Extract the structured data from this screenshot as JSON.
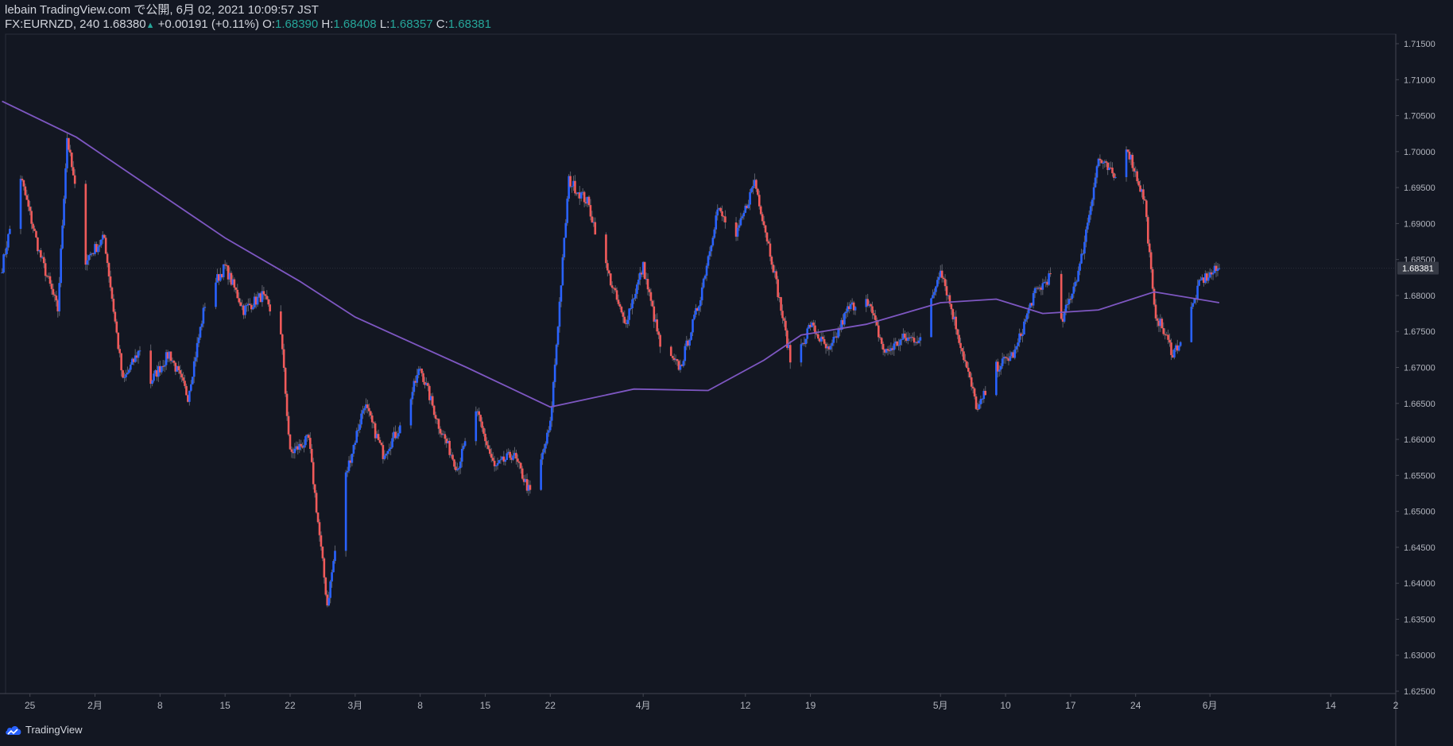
{
  "header": {
    "publish_line": "lebain TradingView.com で公開, 6月 02, 2021 10:09:57 JST",
    "symbol": "FX:EURNZD, 240",
    "last": "1.68380",
    "arrow": "▲",
    "change": "+0.00191 (+0.11%)",
    "o_label": "O:",
    "o_value": "1.68390",
    "h_label": "H:",
    "h_value": "1.68408",
    "l_label": "L:",
    "l_value": "1.68357",
    "c_label": "C:",
    "c_value": "1.68381"
  },
  "brand": {
    "name": "TradingView",
    "logo_icon": "tradingview-cloud-icon"
  },
  "colors": {
    "background": "#131722",
    "up": "#2962ff",
    "down": "#f05a5a",
    "ma_line": "#7e57c2",
    "price_label_bg": "#363a45",
    "axis_text": "#b2b5be"
  },
  "chart_data": {
    "type": "candlestick",
    "series": [
      {
        "name": "EURNZD, 240",
        "kind": "ohlc",
        "anchors": [
          {
            "date": "2021-01-22",
            "close": 1.684
          },
          {
            "date": "2021-01-24",
            "close": 1.6965
          },
          {
            "date": "2021-01-26",
            "close": 1.686
          },
          {
            "date": "2021-01-28",
            "close": 1.678
          },
          {
            "date": "2021-01-29",
            "close": 1.702
          },
          {
            "date": "2021-01-31",
            "close": 1.685
          },
          {
            "date": "2021-02-02",
            "close": 1.688
          },
          {
            "date": "2021-02-04",
            "close": 1.668
          },
          {
            "date": "2021-02-06",
            "close": 1.673
          },
          {
            "date": "2021-02-07",
            "close": 1.668
          },
          {
            "date": "2021-02-09",
            "close": 1.672
          },
          {
            "date": "2021-02-11",
            "close": 1.666
          },
          {
            "date": "2021-02-13",
            "close": 1.68
          },
          {
            "date": "2021-02-15",
            "close": 1.684
          },
          {
            "date": "2021-02-17",
            "close": 1.678
          },
          {
            "date": "2021-02-19",
            "close": 1.68
          },
          {
            "date": "2021-02-21",
            "close": 1.675
          },
          {
            "date": "2021-02-22",
            "close": 1.658
          },
          {
            "date": "2021-02-24",
            "close": 1.66
          },
          {
            "date": "2021-02-26",
            "close": 1.637
          },
          {
            "date": "2021-02-28",
            "close": 1.655
          },
          {
            "date": "2021-03-02",
            "close": 1.665
          },
          {
            "date": "2021-03-04",
            "close": 1.658
          },
          {
            "date": "2021-03-06",
            "close": 1.662
          },
          {
            "date": "2021-03-08",
            "close": 1.67
          },
          {
            "date": "2021-03-10",
            "close": 1.662
          },
          {
            "date": "2021-03-12",
            "close": 1.656
          },
          {
            "date": "2021-03-14",
            "close": 1.664
          },
          {
            "date": "2021-03-16",
            "close": 1.656
          },
          {
            "date": "2021-03-18",
            "close": 1.658
          },
          {
            "date": "2021-03-20",
            "close": 1.652
          },
          {
            "date": "2021-03-22",
            "close": 1.662
          },
          {
            "date": "2021-03-24",
            "close": 1.696
          },
          {
            "date": "2021-03-26",
            "close": 1.693
          },
          {
            "date": "2021-03-28",
            "close": 1.684
          },
          {
            "date": "2021-03-30",
            "close": 1.676
          },
          {
            "date": "2021-04-01",
            "close": 1.684
          },
          {
            "date": "2021-04-03",
            "close": 1.672
          },
          {
            "date": "2021-04-05",
            "close": 1.67
          },
          {
            "date": "2021-04-07",
            "close": 1.679
          },
          {
            "date": "2021-04-09",
            "close": 1.692
          },
          {
            "date": "2021-04-11",
            "close": 1.688
          },
          {
            "date": "2021-04-13",
            "close": 1.696
          },
          {
            "date": "2021-04-15",
            "close": 1.684
          },
          {
            "date": "2021-04-17",
            "close": 1.67
          },
          {
            "date": "2021-04-19",
            "close": 1.676
          },
          {
            "date": "2021-04-21",
            "close": 1.672
          },
          {
            "date": "2021-04-23",
            "close": 1.678
          },
          {
            "date": "2021-04-25",
            "close": 1.68
          },
          {
            "date": "2021-04-27",
            "close": 1.672
          },
          {
            "date": "2021-04-29",
            "close": 1.674
          },
          {
            "date": "2021-05-01",
            "close": 1.674
          },
          {
            "date": "2021-05-03",
            "close": 1.684
          },
          {
            "date": "2021-05-05",
            "close": 1.674
          },
          {
            "date": "2021-05-07",
            "close": 1.664
          },
          {
            "date": "2021-05-09",
            "close": 1.67
          },
          {
            "date": "2021-05-11",
            "close": 1.672
          },
          {
            "date": "2021-05-13",
            "close": 1.68
          },
          {
            "date": "2021-05-15",
            "close": 1.683
          },
          {
            "date": "2021-05-16",
            "close": 1.676
          },
          {
            "date": "2021-05-18",
            "close": 1.684
          },
          {
            "date": "2021-05-20",
            "close": 1.699
          },
          {
            "date": "2021-05-22",
            "close": 1.696
          },
          {
            "date": "2021-05-23",
            "close": 1.701
          },
          {
            "date": "2021-05-25",
            "close": 1.693
          },
          {
            "date": "2021-05-26",
            "close": 1.678
          },
          {
            "date": "2021-05-28",
            "close": 1.672
          },
          {
            "date": "2021-05-29",
            "close": 1.674
          },
          {
            "date": "2021-05-31",
            "close": 1.682
          },
          {
            "date": "2021-06-02",
            "close": 1.6838
          }
        ]
      },
      {
        "name": "",
        "kind": "moving-average",
        "points": [
          {
            "date": "2021-01-22",
            "value": 1.707
          },
          {
            "date": "2021-01-30",
            "value": 1.702
          },
          {
            "date": "2021-02-07",
            "value": 1.695
          },
          {
            "date": "2021-02-15",
            "value": 1.688
          },
          {
            "date": "2021-02-23",
            "value": 1.682
          },
          {
            "date": "2021-03-01",
            "value": 1.677
          },
          {
            "date": "2021-03-07",
            "value": 1.6735
          },
          {
            "date": "2021-03-13",
            "value": 1.67
          },
          {
            "date": "2021-03-22",
            "value": 1.6645
          },
          {
            "date": "2021-03-31",
            "value": 1.667
          },
          {
            "date": "2021-04-08",
            "value": 1.6668
          },
          {
            "date": "2021-04-14",
            "value": 1.671
          },
          {
            "date": "2021-04-18",
            "value": 1.6745
          },
          {
            "date": "2021-04-25",
            "value": 1.676
          },
          {
            "date": "2021-05-03",
            "value": 1.679
          },
          {
            "date": "2021-05-09",
            "value": 1.6795
          },
          {
            "date": "2021-05-14",
            "value": 1.6775
          },
          {
            "date": "2021-05-20",
            "value": 1.678
          },
          {
            "date": "2021-05-26",
            "value": 1.6805
          },
          {
            "date": "2021-06-02",
            "value": 1.679
          }
        ]
      }
    ],
    "current_price": 1.68381,
    "current_price_label": "1.68381",
    "y_ticks": [
      "1.71500",
      "1.71000",
      "1.70500",
      "1.70000",
      "1.69500",
      "1.69000",
      "1.68500",
      "1.68000",
      "1.67500",
      "1.67000",
      "1.66500",
      "1.66000",
      "1.65500",
      "1.65000",
      "1.64500",
      "1.64000",
      "1.63500",
      "1.63000",
      "1.62500"
    ],
    "ylim": [
      1.625,
      1.715
    ],
    "x_ticks": [
      {
        "label": "25",
        "date": "2021-01-25"
      },
      {
        "label": "2月",
        "date": "2021-02-01"
      },
      {
        "label": "8",
        "date": "2021-02-08"
      },
      {
        "label": "15",
        "date": "2021-02-15"
      },
      {
        "label": "22",
        "date": "2021-02-22"
      },
      {
        "label": "3月",
        "date": "2021-03-01"
      },
      {
        "label": "8",
        "date": "2021-03-08"
      },
      {
        "label": "15",
        "date": "2021-03-15"
      },
      {
        "label": "22",
        "date": "2021-03-22"
      },
      {
        "label": "4月",
        "date": "2021-04-01"
      },
      {
        "label": "12",
        "date": "2021-04-12"
      },
      {
        "label": "19",
        "date": "2021-04-19"
      },
      {
        "label": "5月",
        "date": "2021-05-03"
      },
      {
        "label": "10",
        "date": "2021-05-10"
      },
      {
        "label": "17",
        "date": "2021-05-17"
      },
      {
        "label": "24",
        "date": "2021-05-24"
      },
      {
        "label": "6月",
        "date": "2021-06-01"
      },
      {
        "label": "14",
        "date": "2021-06-14"
      },
      {
        "label": "2",
        "date": "2021-06-21"
      }
    ],
    "xlim": [
      "2021-01-24",
      "2021-06-21"
    ]
  }
}
